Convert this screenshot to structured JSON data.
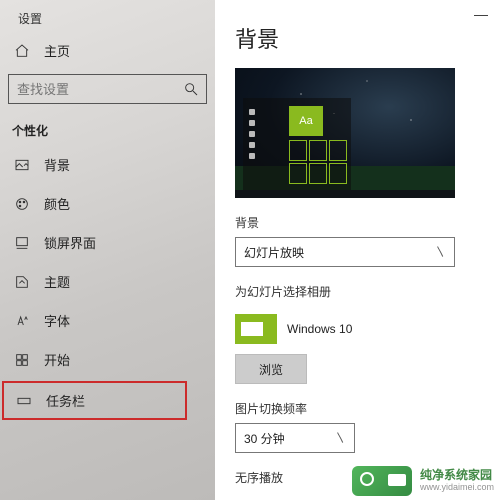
{
  "window": {
    "title": "设置",
    "minimize": "—"
  },
  "sidebar": {
    "home": "主页",
    "search_placeholder": "查找设置",
    "group": "个性化",
    "items": [
      {
        "label": "背景"
      },
      {
        "label": "颜色"
      },
      {
        "label": "锁屏界面"
      },
      {
        "label": "主题"
      },
      {
        "label": "字体"
      },
      {
        "label": "开始"
      },
      {
        "label": "任务栏"
      }
    ]
  },
  "content": {
    "heading": "背景",
    "preview_tile_text": "Aa",
    "bg_label": "背景",
    "bg_value": "幻灯片放映",
    "album_label": "为幻灯片选择相册",
    "album_value": "Windows 10",
    "browse": "浏览",
    "interval_label": "图片切换频率",
    "interval_value": "30 分钟",
    "shuffle_label": "无序播放"
  },
  "watermark": {
    "brand": "纯净系统家园",
    "url": "www.yidaimei.com"
  }
}
